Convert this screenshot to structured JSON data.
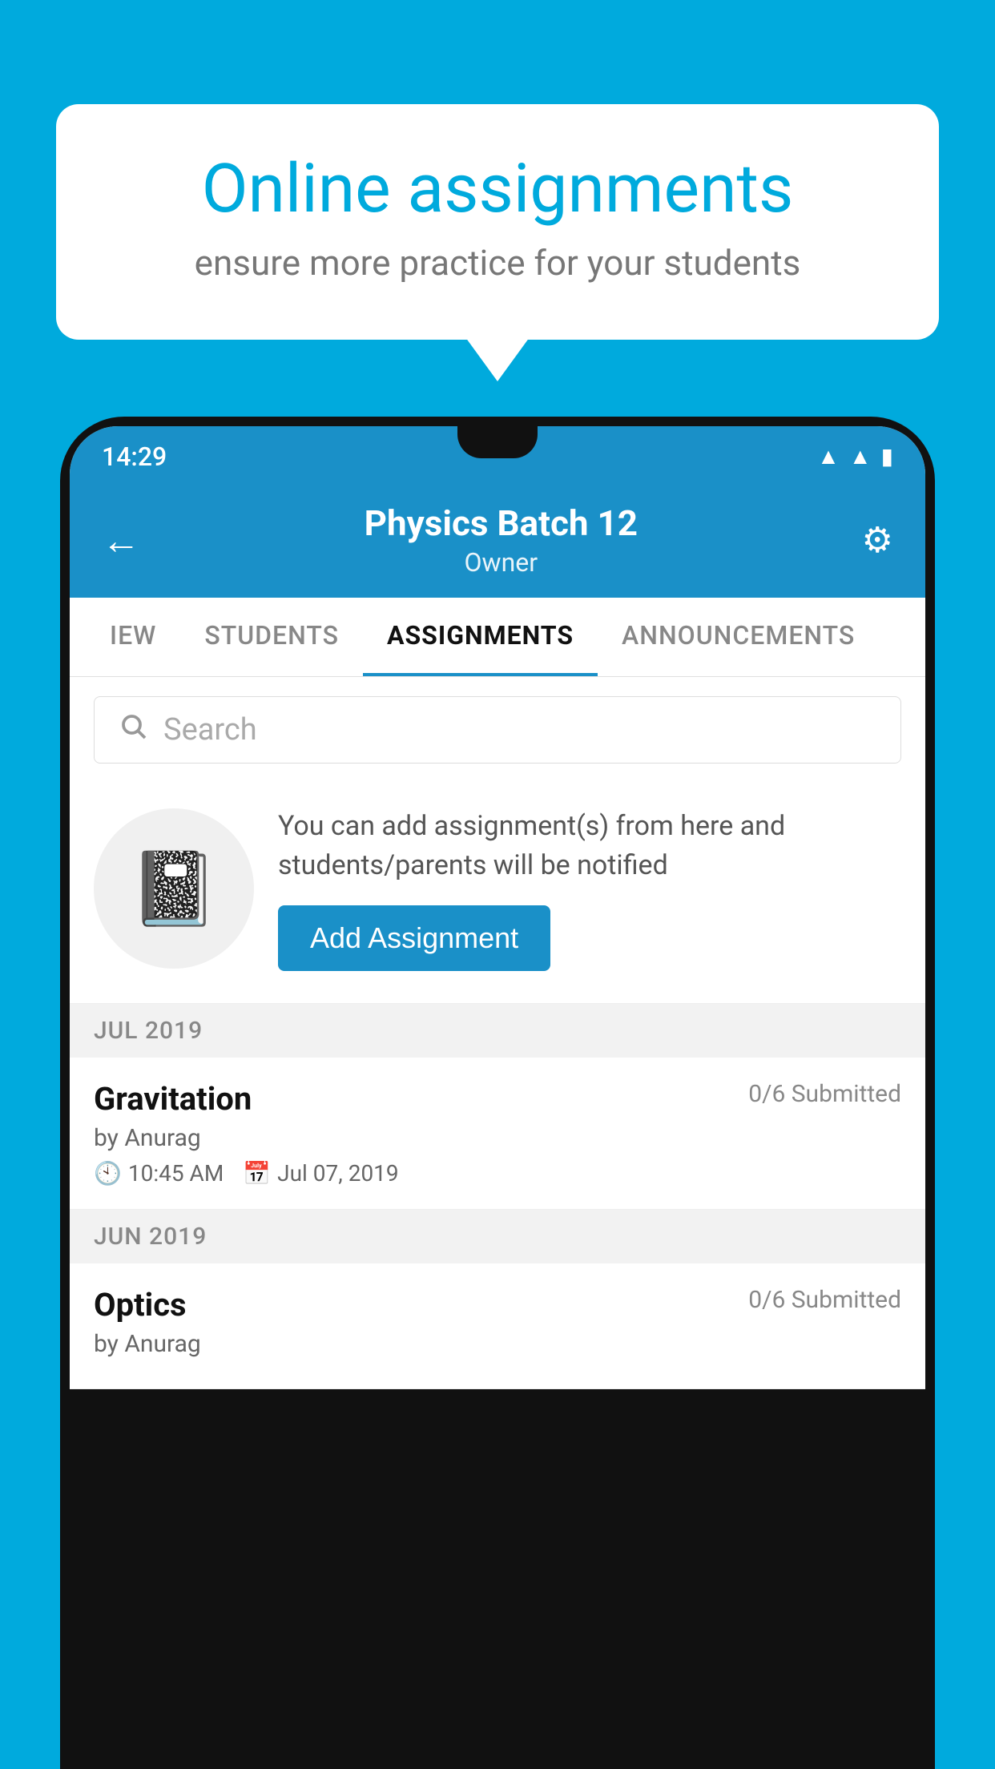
{
  "background": {
    "color": "#00AADD"
  },
  "speech_bubble": {
    "title": "Online assignments",
    "subtitle": "ensure more practice for your students"
  },
  "phone": {
    "status_bar": {
      "time": "14:29",
      "icons": [
        "wifi",
        "signal",
        "battery"
      ]
    },
    "header": {
      "title": "Physics Batch 12",
      "subtitle": "Owner",
      "back_label": "←",
      "gear_label": "⚙"
    },
    "tabs": [
      {
        "label": "IEW",
        "active": false
      },
      {
        "label": "STUDENTS",
        "active": false
      },
      {
        "label": "ASSIGNMENTS",
        "active": true
      },
      {
        "label": "ANNOUNCEMENTS",
        "active": false
      }
    ],
    "search": {
      "placeholder": "Search"
    },
    "add_card": {
      "description": "You can add assignment(s) from here and students/parents will be notified",
      "button_label": "Add Assignment"
    },
    "month_sections": [
      {
        "month": "JUL 2019",
        "assignments": [
          {
            "name": "Gravitation",
            "submitted": "0/6 Submitted",
            "by": "by Anurag",
            "time": "10:45 AM",
            "date": "Jul 07, 2019"
          }
        ]
      },
      {
        "month": "JUN 2019",
        "assignments": [
          {
            "name": "Optics",
            "submitted": "0/6 Submitted",
            "by": "by Anurag",
            "time": "",
            "date": ""
          }
        ]
      }
    ]
  }
}
